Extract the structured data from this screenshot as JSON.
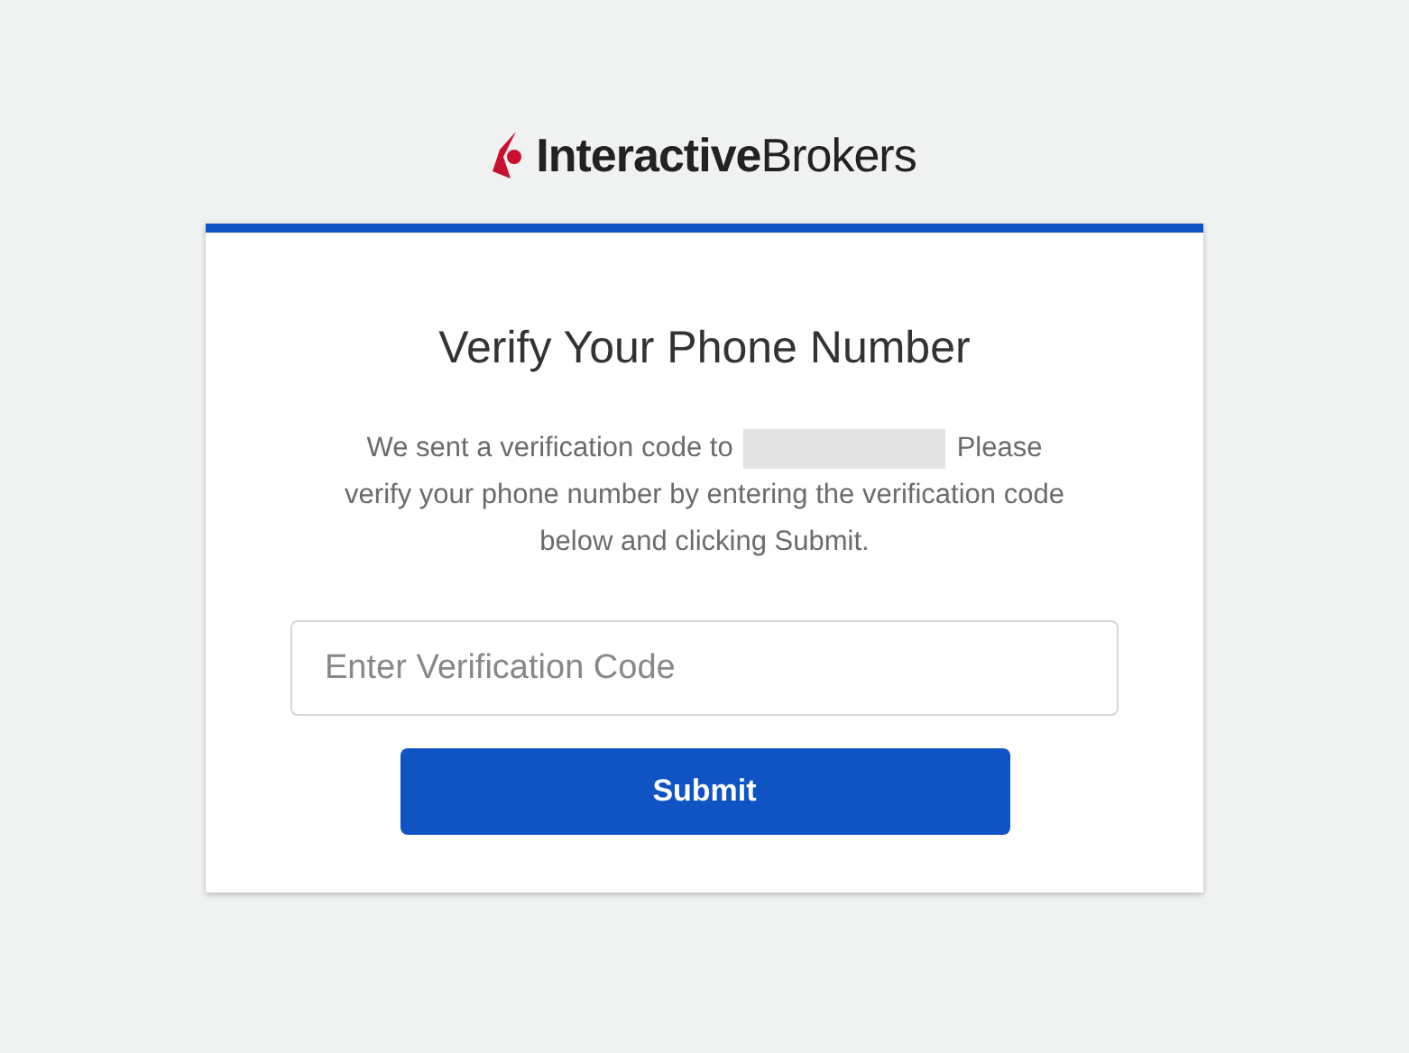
{
  "logo": {
    "text": "**Interactive**Brokers"
  },
  "card": {
    "title": "Verify Your Phone Number",
    "message_before": "We sent a verification code to",
    "message_after": "Please",
    "message_rest": "verify your phone number by entering the verification code below and clicking Submit.",
    "code_field": {
      "placeholder": "Enter Verification Code"
    },
    "submit_button": "Submit"
  }
}
